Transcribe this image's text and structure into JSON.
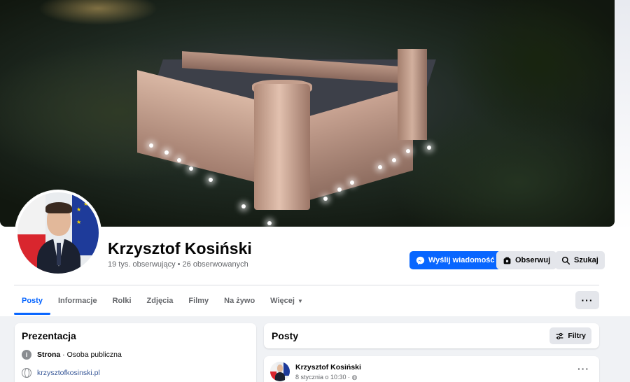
{
  "profile": {
    "name": "Krzysztof Kosiński",
    "stats": "19 tys. obserwujący • 26 obserwowanych"
  },
  "actions": {
    "message_label": "Wyślij wiadomość",
    "follow_label": "Obserwuj",
    "search_label": "Szukaj"
  },
  "tabs": [
    {
      "label": "Posty",
      "active": true
    },
    {
      "label": "Informacje"
    },
    {
      "label": "Rolki"
    },
    {
      "label": "Zdjęcia"
    },
    {
      "label": "Filmy"
    },
    {
      "label": "Na żywo"
    },
    {
      "label": "Więcej"
    }
  ],
  "intro": {
    "title": "Prezentacja",
    "category_bold": "Strona",
    "category_rest": " · Osoba publiczna",
    "website": "krzysztofkosinski.pl"
  },
  "posts": {
    "title": "Posty",
    "filter_label": "Filtry"
  },
  "post": {
    "author": "Krzysztof Kosiński",
    "meta": "8 stycznia o 10:30 · "
  },
  "colors": {
    "accent": "#0866ff",
    "button_gray": "#e4e6eb",
    "background": "#f0f2f5"
  }
}
